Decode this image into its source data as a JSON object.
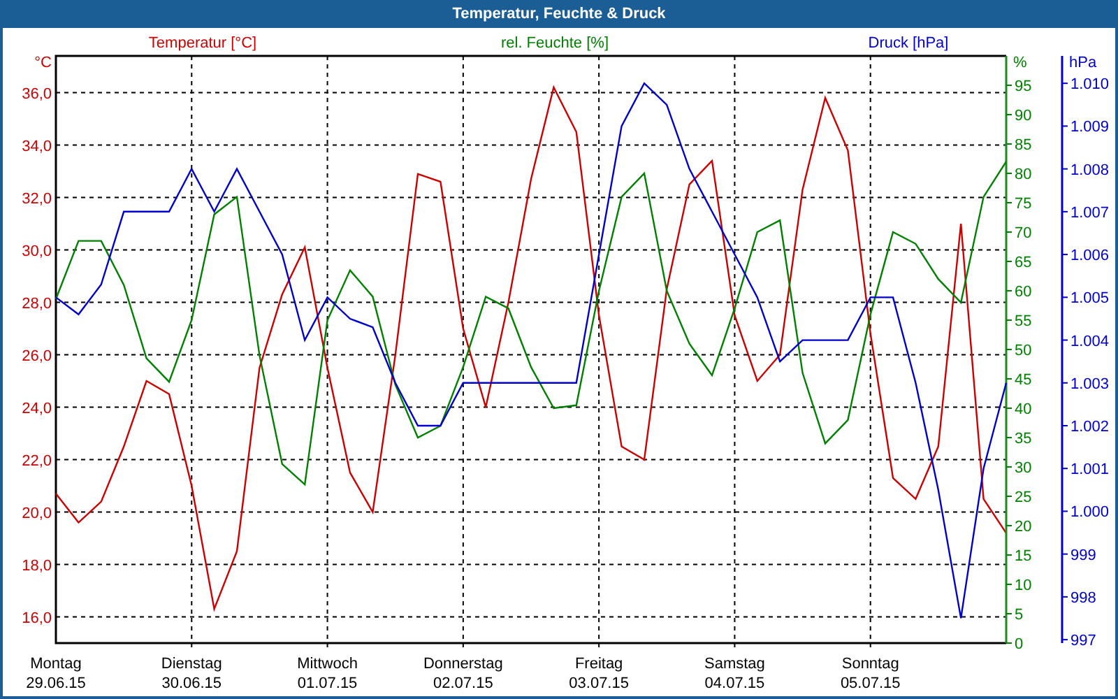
{
  "window": {
    "title": "Temperatur, Feuchte & Druck"
  },
  "chart": {
    "date_labels": [
      "29.06.15",
      "30.06.15",
      "01.07.15",
      "02.07.15",
      "03.07.15",
      "04.07.15",
      "05.07.15"
    ],
    "layers": [
      {
        "unit": "°C",
        "chart_data": {
          "type": "line",
          "grid": true,
          "categories": [
            "Montag",
            null,
            null,
            null,
            null,
            null,
            "Dienstag",
            null,
            null,
            null,
            null,
            null,
            "Mittwoch",
            null,
            null,
            null,
            null,
            null,
            "Donnerstag",
            null,
            null,
            null,
            null,
            null,
            "Freitag",
            null,
            null,
            null,
            null,
            null,
            "Samstag",
            null,
            null,
            null,
            null,
            null,
            "Sonntag",
            null,
            null,
            null,
            null,
            null,
            null
          ],
          "ylim": [
            15,
            37.4
          ],
          "yticks": [
            {
              "value": 16,
              "label": "16,0"
            },
            {
              "value": 18,
              "label": "18,0"
            },
            {
              "value": 20,
              "label": "20,0"
            },
            {
              "value": 22,
              "label": "22,0"
            },
            {
              "value": 24,
              "label": "24,0"
            },
            {
              "value": 26,
              "label": "26,0"
            },
            {
              "value": 28,
              "label": "28,0"
            },
            {
              "value": 30,
              "label": "30,0"
            },
            {
              "value": 32,
              "label": "32,0"
            },
            {
              "value": 34,
              "label": "34,0"
            },
            {
              "value": 36,
              "label": "36,0"
            }
          ],
          "series": [
            {
              "name": "Temperatur [°C]",
              "color": "#cc0000",
              "values": [
                20.7,
                19.6,
                20.4,
                22.5,
                25.0,
                24.5,
                21.0,
                16.3,
                18.5,
                25.5,
                28.3,
                30.1,
                25.5,
                21.5,
                20.0,
                26.0,
                32.9,
                32.6,
                27.0,
                24.0,
                28.0,
                32.7,
                36.2,
                34.5,
                27.5,
                22.5,
                22.0,
                28.5,
                32.5,
                33.4,
                27.5,
                25.0,
                26.0,
                32.3,
                35.8,
                33.8,
                26.8,
                21.3,
                20.5,
                22.5,
                31.0,
                20.5,
                19.2
              ]
            }
          ]
        }
      },
      {
        "unit": "%",
        "chart_data": {
          "type": "line",
          "ylim": [
            0,
            100
          ],
          "yticks": [
            0,
            5,
            10,
            15,
            20,
            25,
            30,
            35,
            40,
            45,
            50,
            55,
            60,
            65,
            70,
            75,
            80,
            85,
            90,
            95
          ],
          "series": [
            {
              "name": "rel. Feuchte [%]",
              "color": "#008000",
              "values": [
                58.6,
                68.5,
                68.5,
                61.0,
                48.5,
                44.5,
                55.0,
                73.0,
                76.0,
                49.0,
                30.5,
                27.0,
                55.0,
                63.5,
                59.0,
                44.0,
                35.0,
                37.0,
                47.0,
                59.0,
                57.0,
                47.0,
                40.0,
                40.5,
                60.0,
                76.0,
                80.0,
                60.0,
                51.0,
                45.6,
                57.0,
                70.0,
                72.0,
                46.0,
                34.0,
                38.0,
                56.0,
                70.0,
                68.0,
                62.0,
                58.0,
                76.0,
                82.0
              ]
            }
          ]
        }
      },
      {
        "unit": "hPa",
        "chart_data": {
          "type": "line",
          "ylim": [
            996.92,
            1010.64
          ],
          "yticks": [
            {
              "value": 997,
              "label": "997"
            },
            {
              "value": 998,
              "label": "998"
            },
            {
              "value": 999,
              "label": "999"
            },
            {
              "value": 1000,
              "label": "1.000"
            },
            {
              "value": 1001,
              "label": "1.001"
            },
            {
              "value": 1002,
              "label": "1.002"
            },
            {
              "value": 1003,
              "label": "1.003"
            },
            {
              "value": 1004,
              "label": "1.004"
            },
            {
              "value": 1005,
              "label": "1.005"
            },
            {
              "value": 1006,
              "label": "1.006"
            },
            {
              "value": 1007,
              "label": "1.007"
            },
            {
              "value": 1008,
              "label": "1.008"
            },
            {
              "value": 1009,
              "label": "1.009"
            },
            {
              "value": 1010,
              "label": "1.010"
            }
          ],
          "series": [
            {
              "name": "Druck [hPa]",
              "color": "#0000cc",
              "values": [
                1005,
                1004.6,
                1005.3,
                1007,
                1007,
                1007,
                1008,
                1007,
                1008,
                1007,
                1006,
                1004,
                1005,
                1004.5,
                1004.3,
                1003,
                1002,
                1002,
                1003,
                1003,
                1003,
                1003,
                1003,
                1003,
                1006,
                1009,
                1010,
                1009.5,
                1008,
                1007,
                1006,
                1005,
                1003.5,
                1004,
                1004,
                1004,
                1005,
                1005,
                1003,
                1000.5,
                997.5,
                1001,
                1003
              ]
            }
          ]
        }
      }
    ]
  }
}
